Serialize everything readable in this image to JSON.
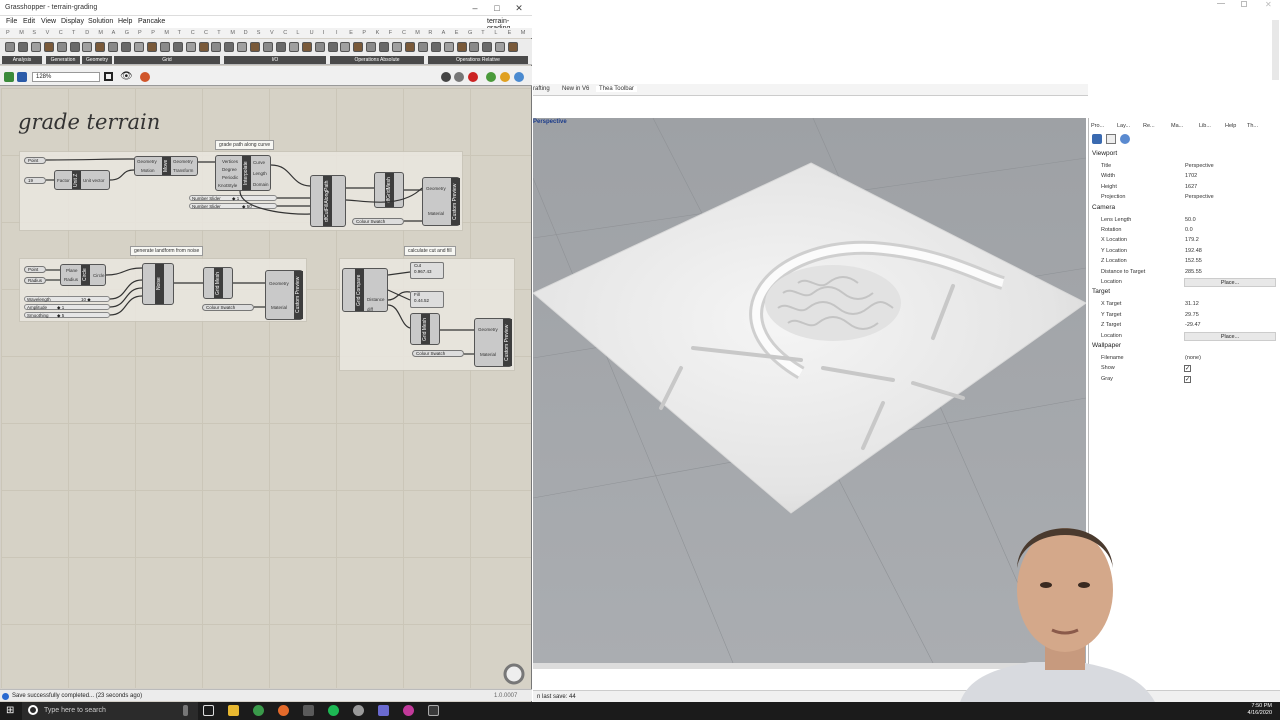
{
  "grasshopper": {
    "title": "Grasshopper - terrain-grading",
    "doc_name": "terrain-grading",
    "menu": [
      "File",
      "Edit",
      "View",
      "Display",
      "Solution",
      "Help",
      "Pancake"
    ],
    "tab_letters": [
      "P",
      "M",
      "S",
      "V",
      "C",
      "T",
      "D",
      "M",
      "A",
      "G",
      "P",
      "P",
      "M",
      "T",
      "C",
      "C",
      "T",
      "M",
      "D",
      "S",
      "V",
      "C",
      "L",
      "U",
      "I",
      "I",
      "E",
      "P",
      "K",
      "F",
      "C",
      "M",
      "R",
      "A",
      "E",
      "G",
      "T",
      "L",
      "E",
      "M"
    ],
    "ribbon_groups": [
      "Analysis",
      "Generation",
      "Geometry",
      "Grid",
      "I/O",
      "Operations Absolute",
      "Operations Relative"
    ],
    "zoom": "128%",
    "canvas_title": "grade terrain",
    "groups": {
      "g1_label": "grade path along curve",
      "g2_label": "generate landform from noise",
      "g3_label": "calculate cut and fill"
    },
    "components": {
      "point": "Point",
      "unitz": "Unit Z",
      "factor": "Factor",
      "unitvector": "Unit vector",
      "geometry": "Geometry",
      "motion": "Motion",
      "move": "Move",
      "transform": "Transform",
      "interpolate": "Interpolate",
      "vertices": "Vertices",
      "degree": "Degree",
      "periodic": "Periodic",
      "knotstyle": "KnotStyle",
      "curve": "Curve",
      "length": "Length",
      "domain": "Domain",
      "dfc": "dfCutFillAlongPath",
      "dfgrid": "dfGridMesh",
      "custompreview": "Custom Preview",
      "material": "Material",
      "colourswatch": "Colour Swatch",
      "numberslider": "Number Slider",
      "plane": "Plane",
      "radius": "Radius",
      "circle": "Circle",
      "noise": "Noise",
      "gridmesh": "Grid Mesh",
      "gridcompare": "Grid Compare",
      "wavelength": "Wavelength",
      "amplitude": "Amplitude",
      "smoothing": "Smoothing",
      "distance": "Distance",
      "cut": "Cut",
      "fill": "Fill",
      "diff": "diff",
      "val_19": "19",
      "val_1": "1",
      "val_10": "10",
      "val_ns1": "◆ 1",
      "val_ns50": "◆ 50",
      "val_one": "◆ 1",
      "val_five": "◆ 5",
      "val_ten": "10 ◆",
      "cut_val": "0.967.43",
      "fill_val": "0.44.52"
    },
    "status": "Save successfully completed... (23 seconds ago)",
    "version": "1.0.0007"
  },
  "rhino": {
    "view_tabs": [
      "rafting",
      "New in V6",
      "Thea Toolbar"
    ],
    "viewport_label": "Perspective",
    "status_left": "n last save: 44",
    "panel_tabs": [
      "Pro...",
      "Lay...",
      "Re...",
      "Ma...",
      "Lib...",
      "Help",
      "Th..."
    ],
    "viewport_section": "Viewport",
    "viewport_props": [
      [
        "Title",
        "Perspective"
      ],
      [
        "Width",
        "1702"
      ],
      [
        "Height",
        "1627"
      ],
      [
        "Projection",
        "Perspective"
      ]
    ],
    "camera_section": "Camera",
    "camera_props": [
      [
        "Lens Length",
        "50.0"
      ],
      [
        "Rotation",
        "0.0"
      ],
      [
        "X Location",
        "179.2"
      ],
      [
        "Y Location",
        "192.48"
      ],
      [
        "Z Location",
        "152.55"
      ],
      [
        "Distance to Target",
        "285.55"
      ],
      [
        "Location",
        "Place..."
      ]
    ],
    "target_section": "Target",
    "target_props": [
      [
        "X Target",
        "31.12"
      ],
      [
        "Y Target",
        "29.75"
      ],
      [
        "Z Target",
        "-29.47"
      ],
      [
        "Location",
        "Place..."
      ]
    ],
    "wallpaper_section": "Wallpaper",
    "wallpaper_props": [
      [
        "Filename",
        "(none)"
      ],
      [
        "Show",
        "✓"
      ],
      [
        "Gray",
        "✓"
      ]
    ]
  },
  "taskbar": {
    "search_placeholder": "Type here to search",
    "time": "7:50 PM",
    "date": "4/16/2020"
  }
}
